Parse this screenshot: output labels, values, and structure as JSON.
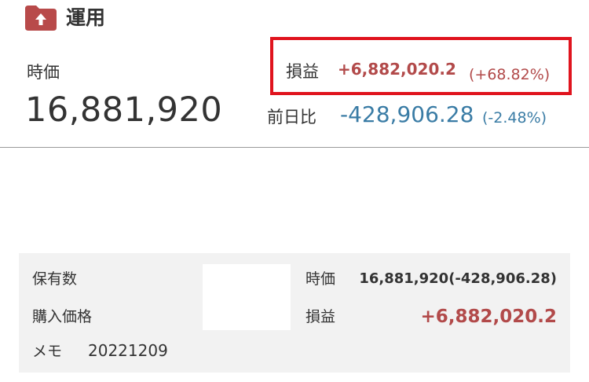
{
  "header": {
    "title": "運用",
    "icon": "folder-up-icon",
    "icon_color": "#b84a4a"
  },
  "summary": {
    "price_label": "時価",
    "price_value": "16,881,920",
    "pnl_label": "損益",
    "pnl_value": "+6,882,020.2",
    "pnl_percent": "(+68.82%)",
    "day_change_label": "前日比",
    "day_change_value": "-428,906.28",
    "day_change_percent": "(-2.48%)"
  },
  "details": {
    "holdings_label": "保有数",
    "purchase_price_label": "購入価格",
    "memo_label": "メモ",
    "memo_value": "20221209",
    "price_label": "時価",
    "price_value": "16,881,920(-428,906.28)",
    "pnl_label": "損益",
    "pnl_value": "+6,882,020.2"
  },
  "colors": {
    "positive": "#b24a4a",
    "negative": "#3a7ca5",
    "highlight_border": "#e0141e"
  }
}
